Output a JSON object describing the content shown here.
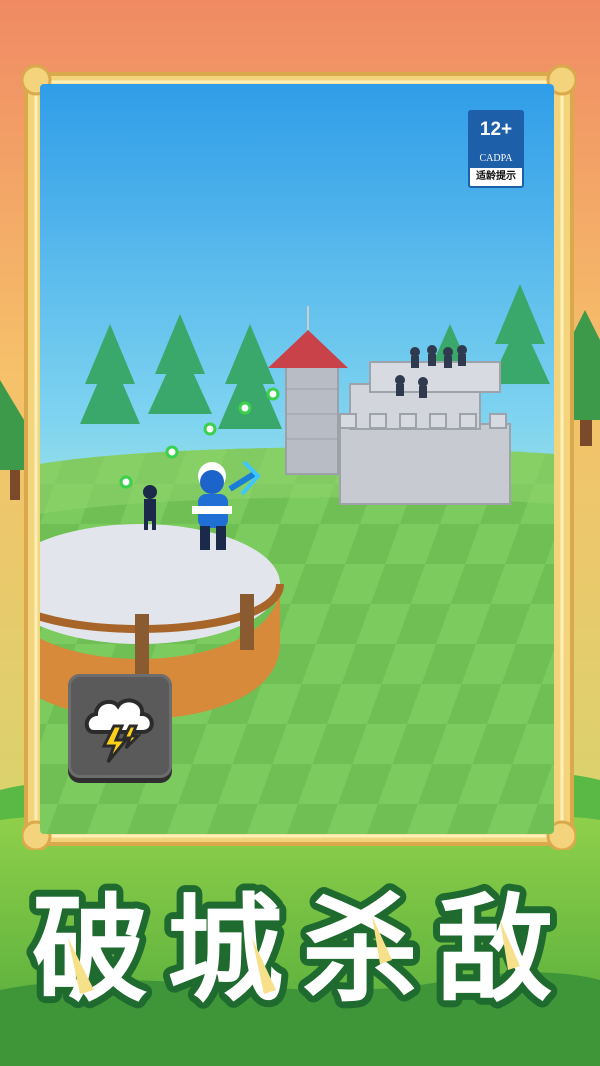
{
  "age_rating": {
    "label": "12+",
    "org": "CADPA",
    "tip": "适龄提示"
  },
  "skill": {
    "icon": "storm-lightning-icon"
  },
  "banner": {
    "characters": [
      "破",
      "城",
      "杀",
      "敌"
    ]
  },
  "colors": {
    "title_fill": "#ffffff",
    "title_stroke": "#1f6a2f",
    "frame_gold": "#f3d37b",
    "badge_blue": "#1d5fa8"
  }
}
